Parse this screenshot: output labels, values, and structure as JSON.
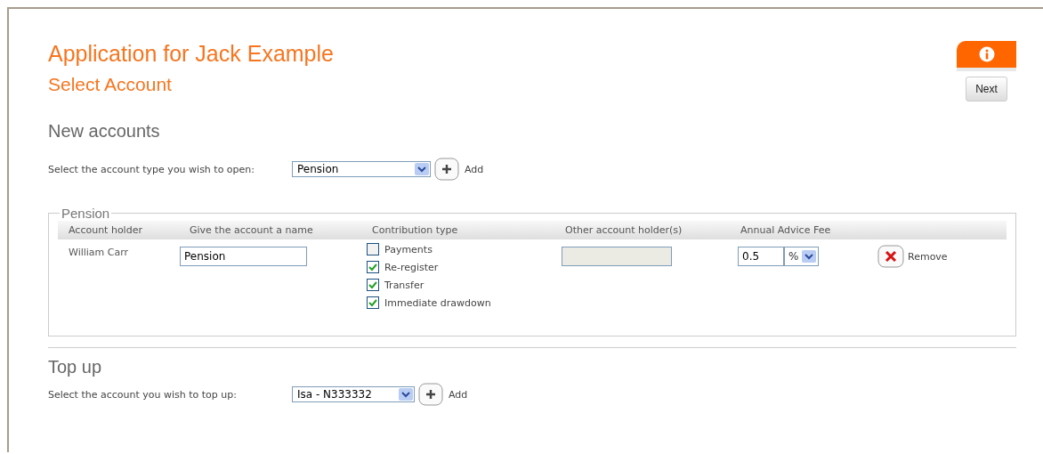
{
  "header": {
    "title": "Application for Jack Example",
    "subtitle": "Select Account",
    "next_button": "Next"
  },
  "new_accounts": {
    "heading": "New accounts",
    "prompt": "Select the account type you wish to open:",
    "select_value": "Pension",
    "add_label": "Add"
  },
  "pension": {
    "legend": "Pension",
    "columns": [
      "Account holder",
      "Give the account a name",
      "Contribution type",
      "Other account holder(s)",
      "Annual Advice Fee"
    ],
    "row": {
      "account_holder": "William Carr",
      "account_name": "Pension",
      "contribution_types": [
        {
          "label": "Payments",
          "checked": false
        },
        {
          "label": "Re-register",
          "checked": true
        },
        {
          "label": "Transfer",
          "checked": true
        },
        {
          "label": "Immediate drawdown",
          "checked": true
        }
      ],
      "other_holders": {
        "disabled": true
      },
      "fee": "0.5",
      "fee_unit": "%",
      "remove_label": "Remove"
    }
  },
  "top_up": {
    "heading": "Top up",
    "prompt": "Select the account you wish to top up:",
    "select_value": "Isa - N333332",
    "add_label": "Add"
  }
}
